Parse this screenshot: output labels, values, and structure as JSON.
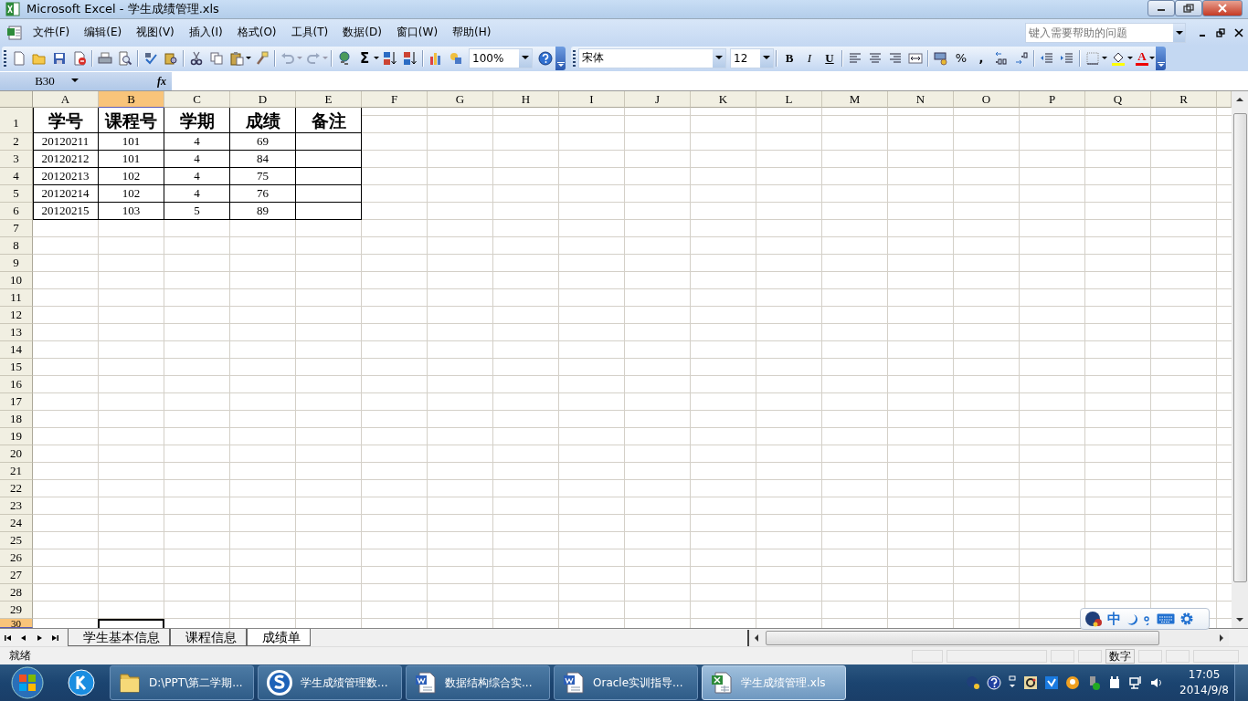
{
  "window": {
    "title": "Microsoft Excel - 学生成绩管理.xls"
  },
  "menu": [
    "文件(F)",
    "编辑(E)",
    "视图(V)",
    "插入(I)",
    "格式(O)",
    "工具(T)",
    "数据(D)",
    "窗口(W)",
    "帮助(H)"
  ],
  "help_box": {
    "placeholder": "键入需要帮助的问题"
  },
  "toolbar": {
    "sum": "Σ",
    "zoom": "100%",
    "font": "宋体",
    "size": "12",
    "bold": "B",
    "italic": "I",
    "underline": "U",
    "percent": "%",
    "comma": ",",
    "font_color": "A"
  },
  "formula_bar": {
    "name_box": "B30",
    "fx": "fx"
  },
  "columns": [
    {
      "label": "A",
      "selected": false
    },
    {
      "label": "B",
      "selected": true
    },
    {
      "label": "C",
      "selected": false
    },
    {
      "label": "D",
      "selected": false
    },
    {
      "label": "E",
      "selected": false
    },
    {
      "label": "F",
      "selected": false
    },
    {
      "label": "G",
      "selected": false
    },
    {
      "label": "H",
      "selected": false
    },
    {
      "label": "I",
      "selected": false
    },
    {
      "label": "J",
      "selected": false
    },
    {
      "label": "K",
      "selected": false
    },
    {
      "label": "L",
      "selected": false
    },
    {
      "label": "M",
      "selected": false
    },
    {
      "label": "N",
      "selected": false
    },
    {
      "label": "O",
      "selected": false
    },
    {
      "label": "P",
      "selected": false
    },
    {
      "label": "Q",
      "selected": false
    },
    {
      "label": "R",
      "selected": false
    }
  ],
  "rows": [
    {
      "label": "1",
      "selected": false
    },
    {
      "label": "2",
      "selected": false
    },
    {
      "label": "3",
      "selected": false
    },
    {
      "label": "4",
      "selected": false
    },
    {
      "label": "5",
      "selected": false
    },
    {
      "label": "6",
      "selected": false
    },
    {
      "label": "7",
      "selected": false
    },
    {
      "label": "8",
      "selected": false
    },
    {
      "label": "9",
      "selected": false
    },
    {
      "label": "10",
      "selected": false
    },
    {
      "label": "11",
      "selected": false
    },
    {
      "label": "12",
      "selected": false
    },
    {
      "label": "13",
      "selected": false
    },
    {
      "label": "14",
      "selected": false
    },
    {
      "label": "15",
      "selected": false
    },
    {
      "label": "16",
      "selected": false
    },
    {
      "label": "17",
      "selected": false
    },
    {
      "label": "18",
      "selected": false
    },
    {
      "label": "19",
      "selected": false
    },
    {
      "label": "20",
      "selected": false
    },
    {
      "label": "21",
      "selected": false
    },
    {
      "label": "22",
      "selected": false
    },
    {
      "label": "23",
      "selected": false
    },
    {
      "label": "24",
      "selected": false
    },
    {
      "label": "25",
      "selected": false
    },
    {
      "label": "26",
      "selected": false
    },
    {
      "label": "27",
      "selected": false
    },
    {
      "label": "28",
      "selected": false
    },
    {
      "label": "29",
      "selected": false
    },
    {
      "label": "30",
      "selected": true
    }
  ],
  "table": {
    "header": [
      "学号",
      "课程号",
      "学期",
      "成绩",
      "备注"
    ],
    "rows": [
      [
        "20120211",
        "101",
        "4",
        "69"
      ],
      [
        "20120212",
        "101",
        "4",
        "84"
      ],
      [
        "20120213",
        "102",
        "4",
        "75"
      ],
      [
        "20120214",
        "102",
        "4",
        "76"
      ],
      [
        "20120215",
        "103",
        "5",
        "89"
      ]
    ]
  },
  "sheet_tabs": [
    {
      "label": "学生基本信息",
      "selected": false
    },
    {
      "label": "课程信息",
      "selected": false
    },
    {
      "label": "成绩单",
      "selected": true
    }
  ],
  "ime_bar": {
    "mode": "中"
  },
  "status_bar": {
    "status": "就绪",
    "num_lock": "数字"
  },
  "taskbar": {
    "buttons": [
      {
        "label": "D:\\PPT\\第二学期...",
        "kind": "folder",
        "selected": false
      },
      {
        "label": "学生成绩管理数...",
        "kind": "browser",
        "selected": false
      },
      {
        "label": "数据结构综合实...",
        "kind": "word",
        "selected": false
      },
      {
        "label": "Oracle实训指导...",
        "kind": "word",
        "selected": false
      },
      {
        "label": "学生成绩管理.xls",
        "kind": "excel",
        "selected": true
      }
    ],
    "clock": {
      "time": "17:05",
      "date": "2014/9/8"
    }
  }
}
